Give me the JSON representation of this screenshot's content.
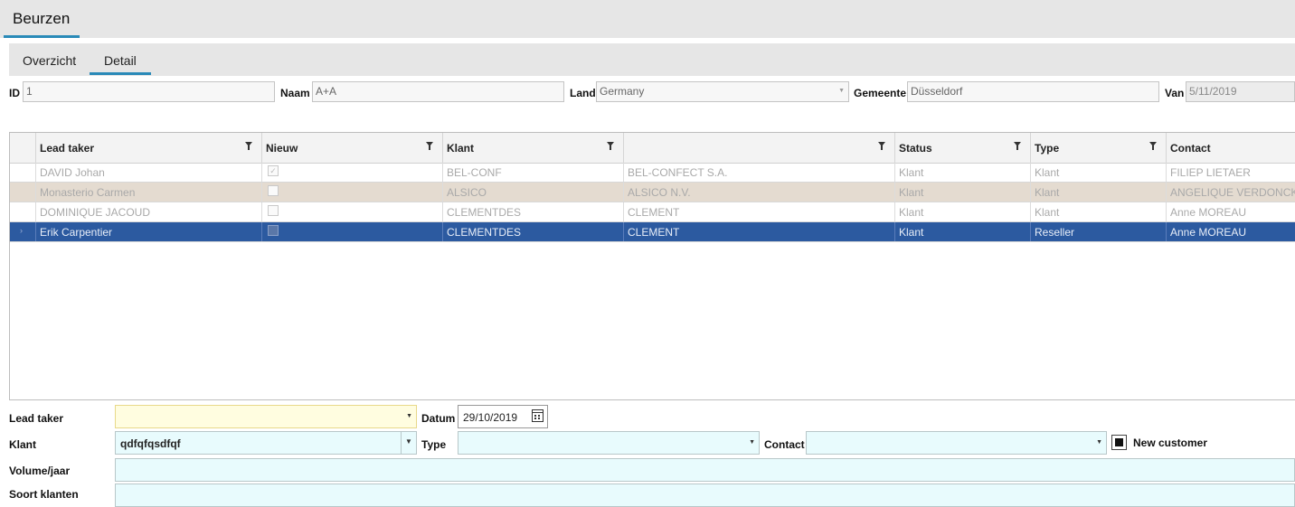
{
  "app": {
    "title": "Beurzen"
  },
  "tabs": [
    {
      "label": "Overzicht",
      "active": false
    },
    {
      "label": "Detail",
      "active": true
    }
  ],
  "header": {
    "id_label": "ID",
    "id_value": "1",
    "naam_label": "Naam",
    "naam_value": "A+A",
    "land_label": "Land",
    "land_value": "Germany",
    "gemeente_label": "Gemeente",
    "gemeente_value": "Düsseldorf",
    "van_label": "Van",
    "van_value": "5/11/2019"
  },
  "grid": {
    "columns": [
      "Lead taker",
      "Nieuw",
      "Klant",
      "",
      "Status",
      "Type",
      "Contact"
    ],
    "rows": [
      {
        "lead_taker": "DAVID Johan",
        "nieuw": true,
        "klant": "BEL-CONF",
        "klant_name": "BEL-CONFECT S.A.",
        "status": "Klant",
        "type": "Klant",
        "contact": "FILIEP LIETAER"
      },
      {
        "lead_taker": "Monasterio Carmen",
        "nieuw": false,
        "klant": "ALSICO",
        "klant_name": "ALSICO N.V.",
        "status": "Klant",
        "type": "Klant",
        "contact": "ANGELIQUE VERDONCKT"
      },
      {
        "lead_taker": "DOMINIQUE JACOUD",
        "nieuw": false,
        "klant": "CLEMENTDES",
        "klant_name": " CLEMENT",
        "status": "Klant",
        "type": "Klant",
        "contact": "Anne MOREAU"
      },
      {
        "lead_taker": "Erik Carpentier",
        "nieuw": false,
        "klant": "CLEMENTDES",
        "klant_name": " CLEMENT",
        "status": "Klant",
        "type": "Reseller",
        "contact": "Anne MOREAU"
      }
    ]
  },
  "form": {
    "lead_taker_label": "Lead taker",
    "lead_taker_value": "",
    "datum_label": "Datum",
    "datum_value": "29/10/2019",
    "klant_label": "Klant",
    "klant_value": "qdfqfqsdfqf",
    "type_label": "Type",
    "type_value": "",
    "contact_label": "Contact",
    "contact_value": "",
    "new_customer_label": "New customer",
    "new_customer_checked": true,
    "volume_label": "Volume/jaar",
    "volume_value": "",
    "soort_label": "Soort klanten",
    "soort_value": ""
  },
  "colors": {
    "accent": "#2a8ab8",
    "selected_row": "#2c5aa0",
    "alt_row": "#e4dbd0",
    "input_bg": "#e8fbfd",
    "lead_input_bg": "#fffde0"
  }
}
